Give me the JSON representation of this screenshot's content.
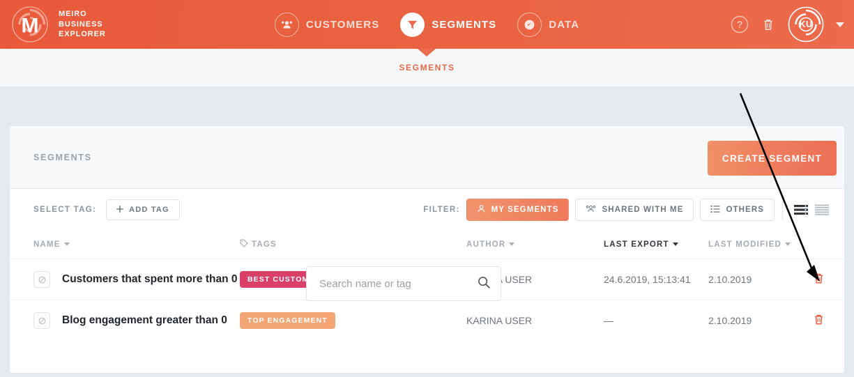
{
  "brand": {
    "logo_icon": "meiro-logo-icon",
    "line1": "MEIRO",
    "line2": "BUSINESS",
    "line3": "EXPLORER"
  },
  "colors": {
    "header_orange": "#ec6b4c",
    "accent_orange": "#e8694a",
    "page_bg": "#e4e9ec",
    "tag_best_customers": "#d93f68",
    "tag_top_engagement": "#f3a673",
    "trash_red": "#ef4726"
  },
  "mainnav": {
    "items": [
      {
        "label": "CUSTOMERS",
        "icon": "customers-group-icon",
        "active": false
      },
      {
        "label": "SEGMENTS",
        "icon": "funnel-filter-icon",
        "active": true
      },
      {
        "label": "DATA",
        "icon": "gauge-meter-icon",
        "active": false
      }
    ]
  },
  "header_right": {
    "help_icon": "question-mark-circle-icon",
    "trash_icon": "trash-icon",
    "avatar_initials": "KU",
    "avatar_icon": "user-avatar-icon",
    "caret_icon": "chevron-down-icon"
  },
  "subnav": {
    "label": "SEGMENTS"
  },
  "card_top": {
    "title": "SEGMENTS",
    "search": {
      "placeholder": "Search name or tag",
      "value": "",
      "icon": "search-icon"
    },
    "create_button": "CREATE SEGMENT"
  },
  "filterbar": {
    "select_tag_label": "SELECT TAG:",
    "add_tag_button": "ADD TAG",
    "add_tag_icon": "plus-icon",
    "filter_label": "FILTER:",
    "filters": [
      {
        "label": "MY SEGMENTS",
        "icon": "person-icon",
        "active": true
      },
      {
        "label": "SHARED WITH ME",
        "icon": "people-shared-icon",
        "active": false
      },
      {
        "label": "OTHERS",
        "icon": "list-icon",
        "active": false
      }
    ],
    "views": [
      {
        "icon": "list-view-icon",
        "active": true
      },
      {
        "icon": "compact-view-icon",
        "active": false
      }
    ]
  },
  "table": {
    "columns": [
      {
        "label": "NAME",
        "sortable": true,
        "active": false,
        "icon": ""
      },
      {
        "label": "TAGS",
        "sortable": false,
        "active": false,
        "icon": "tag-icon"
      },
      {
        "label": "AUTHOR",
        "sortable": true,
        "active": false,
        "icon": ""
      },
      {
        "label": "LAST EXPORT",
        "sortable": true,
        "active": true,
        "icon": ""
      },
      {
        "label": "LAST MODIFIED",
        "sortable": true,
        "active": false,
        "icon": ""
      }
    ],
    "rows": [
      {
        "visibility_icon": "hidden-slashed-circle-icon",
        "name": "Customers that spent more than 0",
        "tag": "BEST CUSTOMERS",
        "tag_color": "#d93f68",
        "author": "KARINA USER",
        "last_export": "24.6.2019, 15:13:41",
        "last_modified": "2.10.2019",
        "delete_icon": "trash-icon"
      },
      {
        "visibility_icon": "hidden-slashed-circle-icon",
        "name": "Blog engagement greater than 0",
        "tag": "TOP ENGAGEMENT",
        "tag_color": "#f3a673",
        "author": "KARINA USER",
        "last_export": "—",
        "last_modified": "2.10.2019",
        "delete_icon": "trash-icon"
      }
    ]
  },
  "annotation": {
    "arrow_icon": "annotation-arrow-icon",
    "color": "#000000"
  }
}
